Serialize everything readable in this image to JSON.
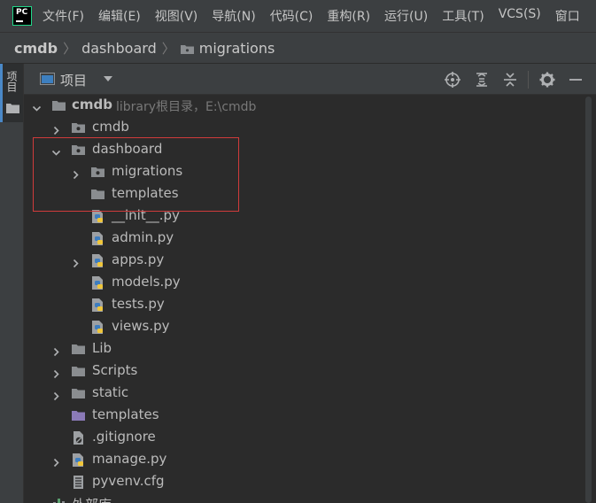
{
  "menubar": {
    "logo_text": "PC",
    "items": [
      "文件(F)",
      "编辑(E)",
      "视图(V)",
      "导航(N)",
      "代码(C)",
      "重构(R)",
      "运行(U)",
      "工具(T)",
      "VCS(S)",
      "窗口"
    ]
  },
  "breadcrumb": [
    "cmdb",
    "dashboard",
    "migrations"
  ],
  "left_strip": {
    "project_tab": "项目"
  },
  "tool_window": {
    "title": "项目",
    "buttons": [
      "locate-icon",
      "expand-all-icon",
      "collapse-all-icon",
      "gear-icon",
      "minimize-icon"
    ]
  },
  "tree": [
    {
      "label": "cmdb",
      "hint": "library根目录，E:\\cmdb",
      "icon": "folder-icon",
      "arrow": "down",
      "bold": true
    },
    {
      "label": "cmdb",
      "icon": "package-icon",
      "arrow": "right"
    },
    {
      "label": "dashboard",
      "icon": "package-icon",
      "arrow": "down"
    },
    {
      "label": "migrations",
      "icon": "package-icon",
      "arrow": "right"
    },
    {
      "label": "templates",
      "icon": "folder-icon",
      "arrow": ""
    },
    {
      "label": "__init__.py",
      "icon": "python-file-icon",
      "arrow": ""
    },
    {
      "label": "admin.py",
      "icon": "python-file-icon",
      "arrow": ""
    },
    {
      "label": "apps.py",
      "icon": "python-file-icon",
      "arrow": "right"
    },
    {
      "label": "models.py",
      "icon": "python-file-icon",
      "arrow": ""
    },
    {
      "label": "tests.py",
      "icon": "python-file-icon",
      "arrow": ""
    },
    {
      "label": "views.py",
      "icon": "python-file-icon",
      "arrow": ""
    },
    {
      "label": "Lib",
      "icon": "folder-icon",
      "arrow": "right"
    },
    {
      "label": "Scripts",
      "icon": "folder-icon",
      "arrow": "right"
    },
    {
      "label": "static",
      "icon": "folder-icon",
      "arrow": "right"
    },
    {
      "label": "templates",
      "icon": "templates-folder-icon",
      "arrow": ""
    },
    {
      "label": ".gitignore",
      "icon": "gitignore-file-icon",
      "arrow": ""
    },
    {
      "label": "manage.py",
      "icon": "python-file-icon",
      "arrow": "right"
    },
    {
      "label": "pyvenv.cfg",
      "icon": "config-file-icon",
      "arrow": ""
    },
    {
      "label": "外部库",
      "icon": "external-libraries-icon",
      "arrow": "down"
    }
  ],
  "colors": {
    "folder": "#8a8d90",
    "templates_folder": "#8b7ab8",
    "highlight_box": "#d03b3b",
    "python_blue": "#3e7dbf",
    "python_yellow": "#f0c63a"
  }
}
